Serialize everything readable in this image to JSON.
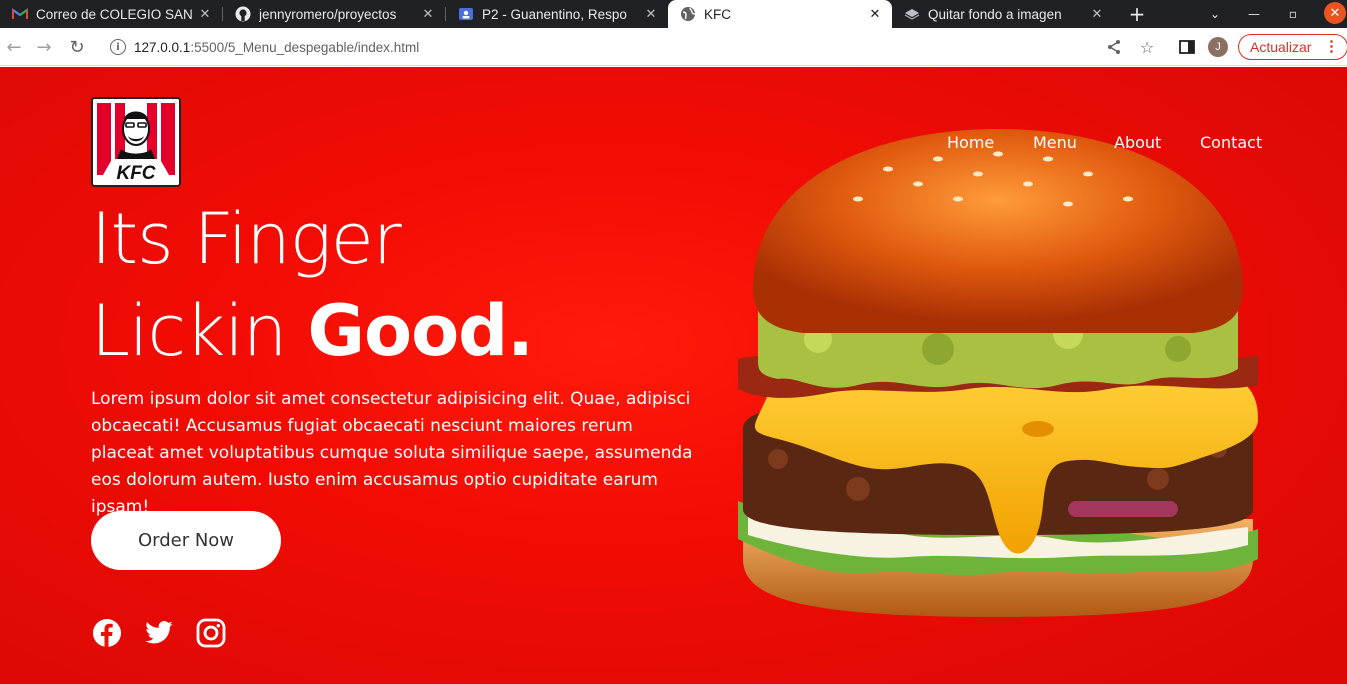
{
  "browser": {
    "tabs": [
      {
        "title": "Correo de COLEGIO SAN",
        "icon": "gmail-icon"
      },
      {
        "title": "jennyromero/proyectos",
        "icon": "github-icon"
      },
      {
        "title": "P2 - Guanentino, Respo",
        "icon": "classroom-icon"
      },
      {
        "title": "KFC",
        "icon": "globe-icon",
        "active": true
      },
      {
        "title": "Quitar fondo a imagen",
        "icon": "layers-icon"
      }
    ],
    "url_host": "127.0.0.1",
    "url_rest": ":5500/5_Menu_despegable/index.html",
    "profile_initial": "J",
    "update_label": "Actualizar",
    "update_color": "#d93025"
  },
  "page": {
    "brand_text": "KFC",
    "nav": [
      "Home",
      "Menu",
      "About",
      "Contact"
    ],
    "headline_line1": "Its Finger",
    "headline_line2_light": "Lickin ",
    "headline_line2_bold": "Good.",
    "description": "Lorem ipsum dolor sit amet consectetur adipisicing elit. Quae, adipisci obcaecati! Accusamus fugiat obcaecati nesciunt maiores rerum placeat amet voluptatibus cumque soluta similique saepe, assumenda eos dolorum autem. Iusto enim accusamus optio cupiditate earum ipsam!",
    "cta_label": "Order Now",
    "social": [
      "facebook-icon",
      "twitter-icon",
      "instagram-icon"
    ],
    "background_color": "#f20c05",
    "hero_image": "burger-image"
  }
}
